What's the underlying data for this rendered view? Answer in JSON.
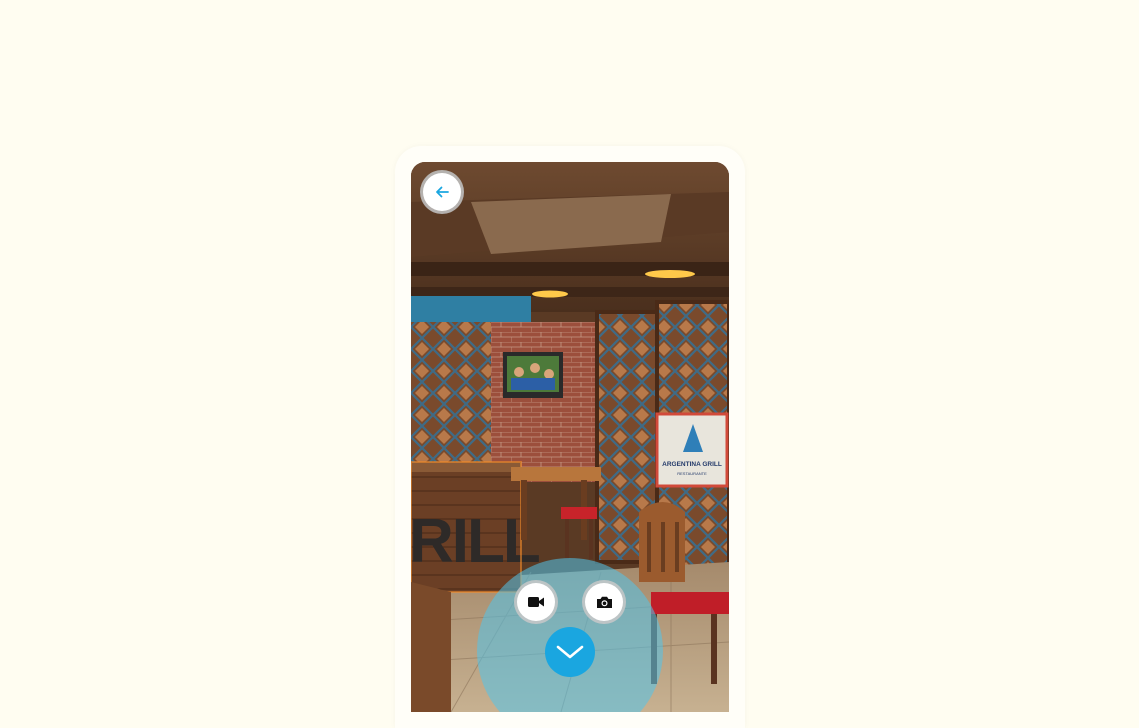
{
  "camera_view": {
    "scene_sign": {
      "line1": "ARGENTINA GRILL",
      "line2": "RESTAURANTE"
    },
    "counter_letters": "RILL"
  },
  "controls": {
    "back_icon": "arrow-left-icon",
    "video_icon": "video-camera-icon",
    "photo_icon": "camera-icon",
    "confirm_icon": "chevron-down-icon"
  },
  "colors": {
    "page_background": "#fffdf1",
    "accent": "#1aa6e0",
    "ring": "#52c4eb"
  }
}
